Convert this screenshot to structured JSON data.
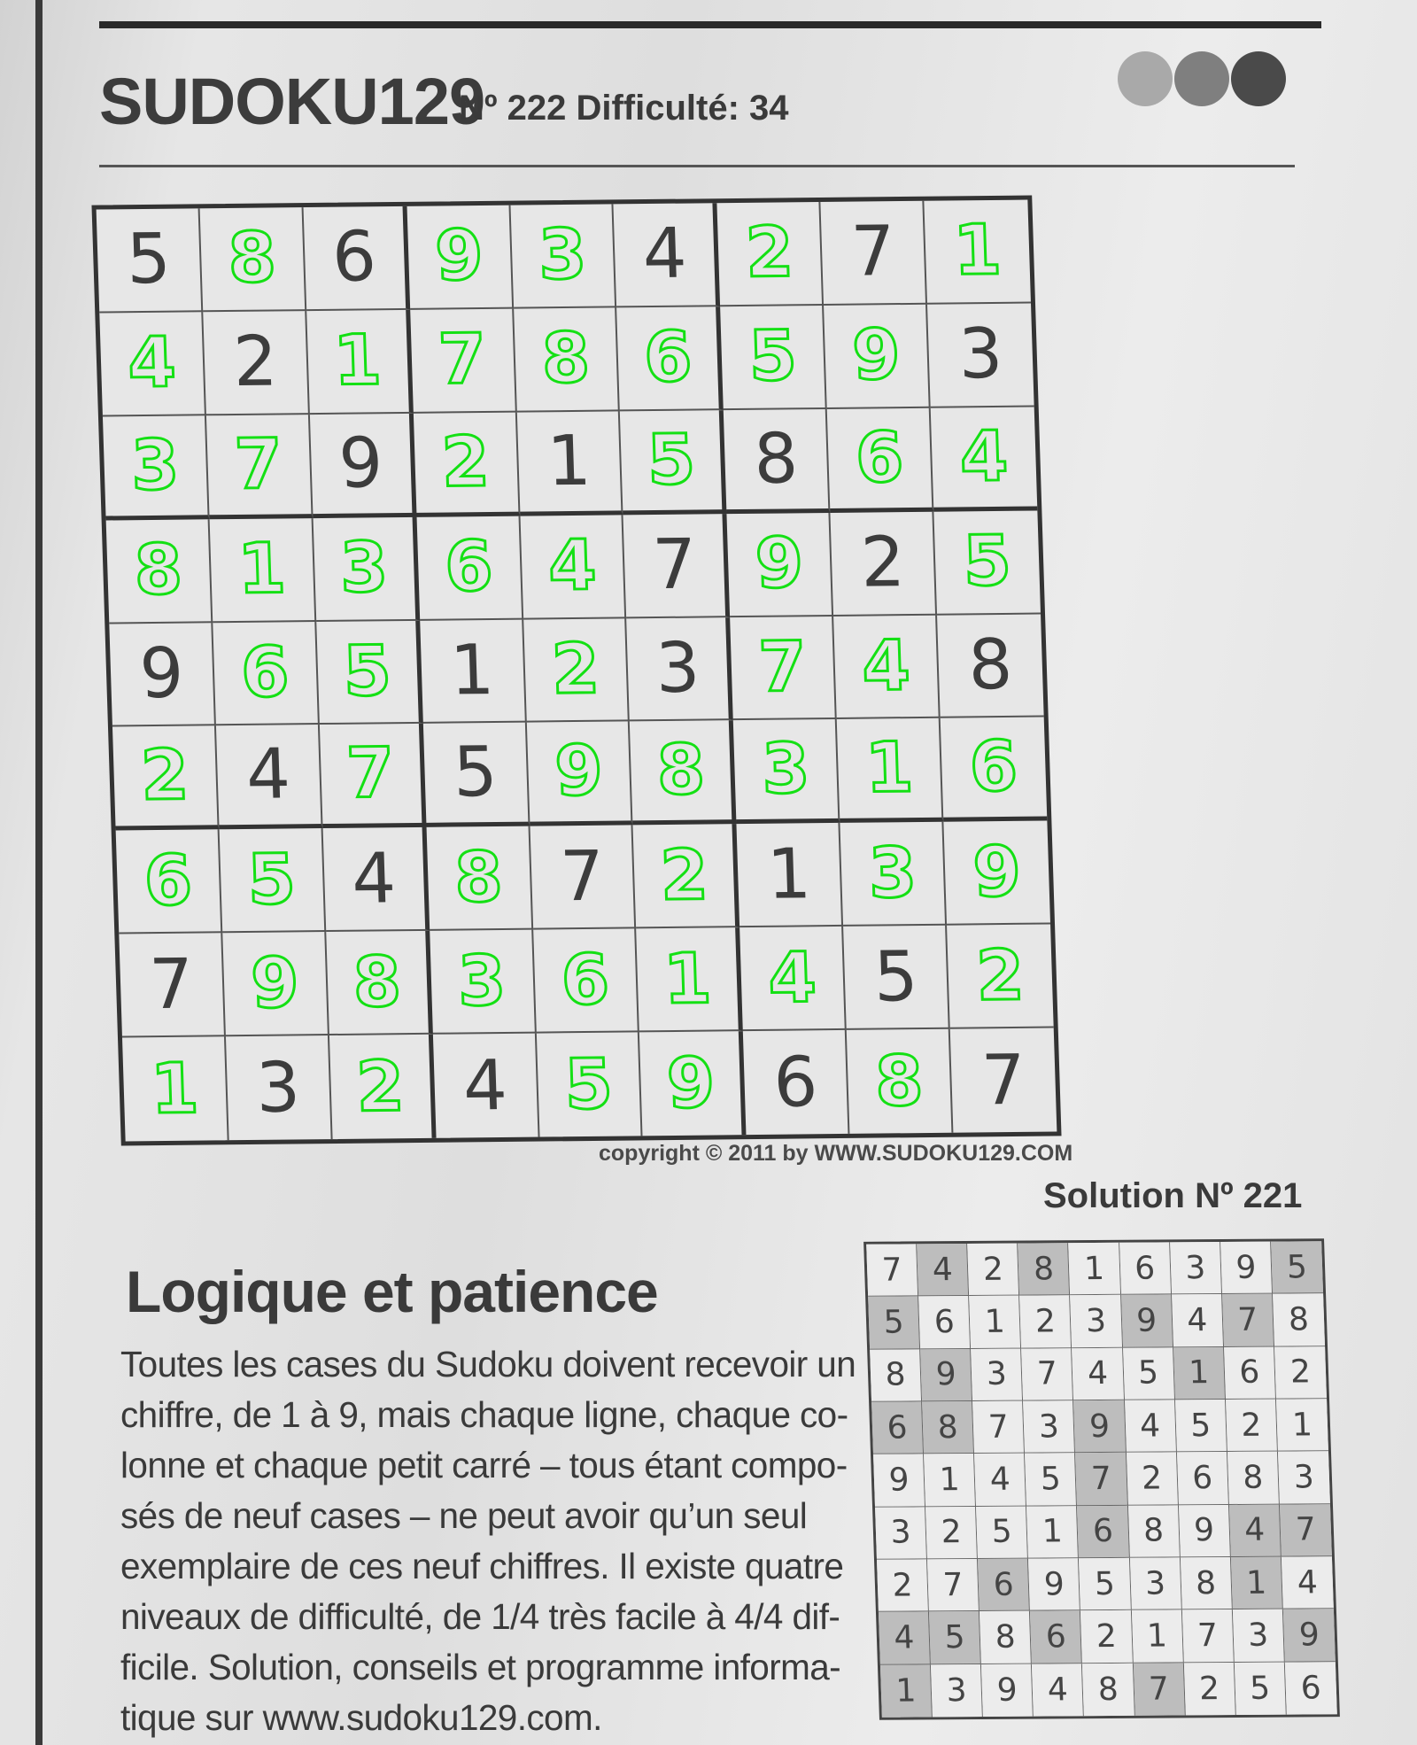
{
  "header": {
    "logo_text": "SUDOKU129",
    "puzzle_info": "Nº 222 Difficulté: 34",
    "difficulty_dot_colors": [
      "#a9a9a9",
      "#7f7f7f",
      "#4a4a4a"
    ]
  },
  "puzzle": {
    "rows": [
      [
        "5",
        "8",
        "6",
        "9",
        "3",
        "4",
        "2",
        "7",
        "1"
      ],
      [
        "4",
        "2",
        "1",
        "7",
        "8",
        "6",
        "5",
        "9",
        "3"
      ],
      [
        "3",
        "7",
        "9",
        "2",
        "1",
        "5",
        "8",
        "6",
        "4"
      ],
      [
        "8",
        "1",
        "3",
        "6",
        "4",
        "7",
        "9",
        "2",
        "5"
      ],
      [
        "9",
        "6",
        "5",
        "1",
        "2",
        "3",
        "7",
        "4",
        "8"
      ],
      [
        "2",
        "4",
        "7",
        "5",
        "9",
        "8",
        "3",
        "1",
        "6"
      ],
      [
        "6",
        "5",
        "4",
        "8",
        "7",
        "2",
        "1",
        "3",
        "9"
      ],
      [
        "7",
        "9",
        "8",
        "3",
        "6",
        "1",
        "4",
        "5",
        "2"
      ],
      [
        "1",
        "3",
        "2",
        "4",
        "5",
        "9",
        "6",
        "8",
        "7"
      ]
    ],
    "filled_mask": [
      [
        0,
        1,
        0,
        1,
        1,
        0,
        1,
        0,
        1
      ],
      [
        1,
        0,
        1,
        1,
        1,
        1,
        1,
        1,
        0
      ],
      [
        1,
        1,
        0,
        1,
        0,
        1,
        0,
        1,
        1
      ],
      [
        1,
        1,
        1,
        1,
        1,
        0,
        1,
        0,
        1
      ],
      [
        0,
        1,
        1,
        0,
        1,
        0,
        1,
        1,
        0
      ],
      [
        1,
        0,
        1,
        0,
        1,
        1,
        1,
        1,
        1
      ],
      [
        1,
        1,
        0,
        1,
        0,
        1,
        0,
        1,
        1
      ],
      [
        0,
        1,
        1,
        1,
        1,
        1,
        1,
        0,
        1
      ],
      [
        1,
        0,
        1,
        0,
        1,
        1,
        0,
        1,
        0
      ]
    ],
    "given_color": "#3c3c3c",
    "filled_color": "#14e014",
    "copyright": "copyright © 2011 by WWW.SUDOKU129.COM"
  },
  "solution": {
    "title": "Solution Nº 221",
    "rows": [
      [
        "7",
        "4",
        "2",
        "8",
        "1",
        "6",
        "3",
        "9",
        "5"
      ],
      [
        "5",
        "6",
        "1",
        "2",
        "3",
        "9",
        "4",
        "7",
        "8"
      ],
      [
        "8",
        "9",
        "3",
        "7",
        "4",
        "5",
        "1",
        "6",
        "2"
      ],
      [
        "6",
        "8",
        "7",
        "3",
        "9",
        "4",
        "5",
        "2",
        "1"
      ],
      [
        "9",
        "1",
        "4",
        "5",
        "7",
        "2",
        "6",
        "8",
        "3"
      ],
      [
        "3",
        "2",
        "5",
        "1",
        "6",
        "8",
        "9",
        "4",
        "7"
      ],
      [
        "2",
        "7",
        "6",
        "9",
        "5",
        "3",
        "8",
        "1",
        "4"
      ],
      [
        "4",
        "5",
        "8",
        "6",
        "2",
        "1",
        "7",
        "3",
        "9"
      ],
      [
        "1",
        "3",
        "9",
        "4",
        "8",
        "7",
        "2",
        "5",
        "6"
      ]
    ],
    "shaded_mask": [
      [
        0,
        1,
        0,
        1,
        0,
        0,
        0,
        0,
        1
      ],
      [
        1,
        0,
        0,
        0,
        0,
        1,
        0,
        1,
        0
      ],
      [
        0,
        1,
        0,
        0,
        0,
        0,
        1,
        0,
        0
      ],
      [
        1,
        1,
        0,
        0,
        1,
        0,
        0,
        0,
        0
      ],
      [
        0,
        0,
        0,
        0,
        1,
        0,
        0,
        0,
        0
      ],
      [
        0,
        0,
        0,
        0,
        1,
        0,
        0,
        1,
        1
      ],
      [
        0,
        0,
        1,
        0,
        0,
        0,
        0,
        1,
        0
      ],
      [
        1,
        1,
        0,
        1,
        0,
        0,
        0,
        0,
        1
      ],
      [
        1,
        0,
        0,
        0,
        0,
        1,
        0,
        0,
        0
      ]
    ]
  },
  "article": {
    "title": "Logique et patience",
    "lines": [
      "Toutes les cases du Sudoku doivent recevoir un",
      "chiffre, de 1 à 9, mais chaque ligne, chaque co-",
      "lonne et chaque petit carré – tous étant compo-",
      "sés de neuf cases – ne peut avoir qu’un seul",
      "exemplaire de ces neuf chiffres. Il existe quatre",
      "niveaux de difficulté, de 1/4 très facile à 4/4 dif-",
      "ficile. Solution, conseils et programme informa-",
      "tique sur www.sudoku129.com."
    ]
  }
}
